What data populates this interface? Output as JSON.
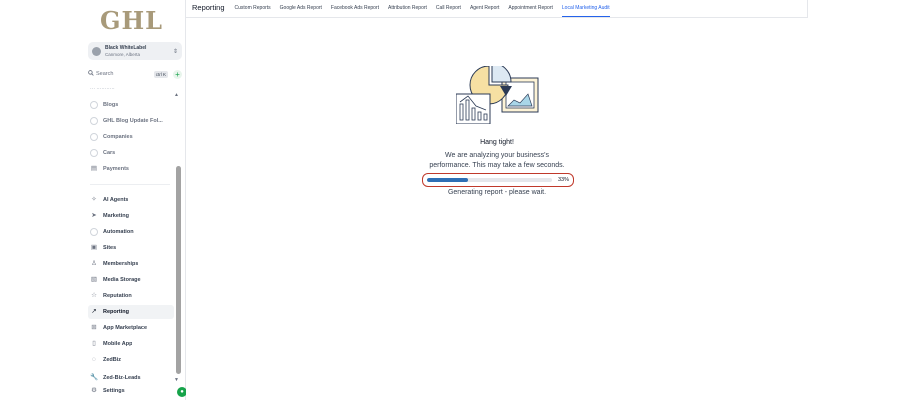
{
  "sidebar": {
    "logo": "GHL",
    "account": {
      "name": "Black WhiteLabel",
      "location": "Canmore, Alberta"
    },
    "search": {
      "label": "Search",
      "shortcut": "ctrl K"
    },
    "truncated_item": "··· ···········",
    "items": [
      {
        "label": "Blogs",
        "icon": "dot-icon"
      },
      {
        "label": "GHL Blog Update Fol...",
        "icon": "dot-icon"
      },
      {
        "label": "Companies",
        "icon": "dot-icon"
      },
      {
        "label": "Cars",
        "icon": "dot-icon"
      },
      {
        "label": "Payments",
        "icon": "payments-icon"
      },
      {
        "label": "AI Agents",
        "icon": "ai-agents-icon"
      },
      {
        "label": "Marketing",
        "icon": "marketing-icon"
      },
      {
        "label": "Automation",
        "icon": "automation-icon"
      },
      {
        "label": "Sites",
        "icon": "sites-icon"
      },
      {
        "label": "Memberships",
        "icon": "memberships-icon"
      },
      {
        "label": "Media Storage",
        "icon": "media-storage-icon"
      },
      {
        "label": "Reputation",
        "icon": "reputation-icon"
      },
      {
        "label": "Reporting",
        "icon": "reporting-icon",
        "active": true
      },
      {
        "label": "App Marketplace",
        "icon": "app-marketplace-icon"
      },
      {
        "label": "Mobile App",
        "icon": "mobile-app-icon"
      },
      {
        "label": "ZedBiz",
        "icon": "zedbiz-icon"
      },
      {
        "label": "Zed-Biz-Leads",
        "icon": "wrench-icon"
      },
      {
        "label": "Settings",
        "icon": "settings-icon"
      }
    ]
  },
  "topbar": {
    "title": "Reporting",
    "tabs": [
      "Custom Reports",
      "Google Ads Report",
      "Facebook Ads Report",
      "Attribution Report",
      "Call Report",
      "Agent Report",
      "Appointment Report",
      "Local Marketing Audit"
    ],
    "active_tab": "Local Marketing Audit"
  },
  "main": {
    "heading": "Hang tight!",
    "message_line1": "We are analyzing your business's",
    "message_line2": "performance. This may take a few seconds.",
    "progress_percent": 33,
    "progress_label": "33%",
    "status": "Generating report - please wait."
  },
  "colors": {
    "accent": "#2563eb",
    "progress_fill": "#2e6fb5",
    "progress_highlight": "#c0392b",
    "brand_logo": "#a89a7a",
    "help_button": "#16a34a"
  }
}
